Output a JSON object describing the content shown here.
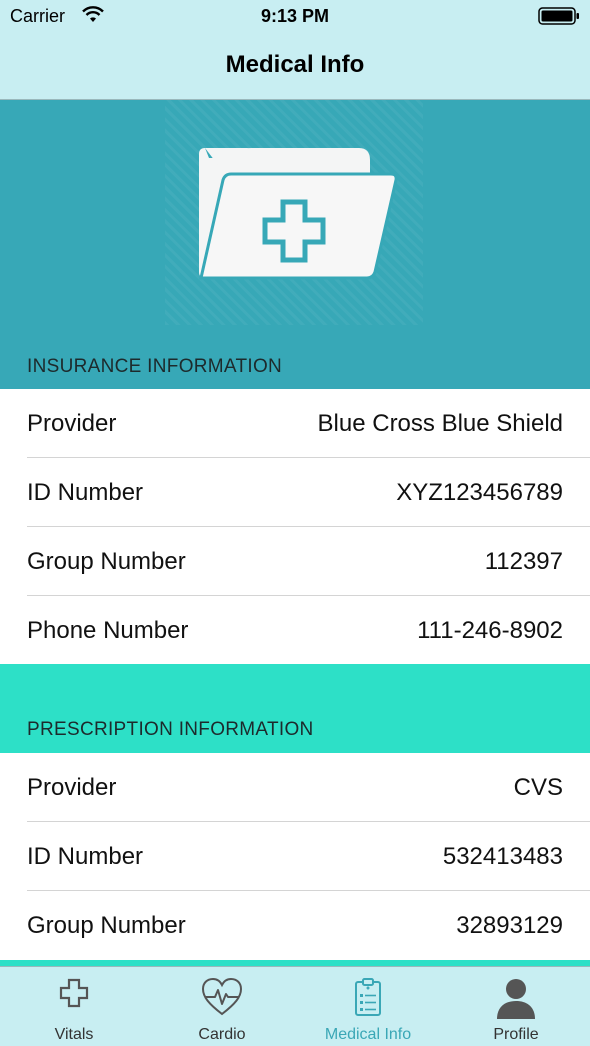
{
  "status_bar": {
    "carrier": "Carrier",
    "time": "9:13 PM"
  },
  "nav": {
    "title": "Medical Info"
  },
  "hero": {
    "icon": "medical-folder-icon"
  },
  "insurance": {
    "header": "INSURANCE INFORMATION",
    "rows": [
      {
        "label": "Provider",
        "value": "Blue Cross Blue Shield"
      },
      {
        "label": "ID Number",
        "value": "XYZ123456789"
      },
      {
        "label": "Group Number",
        "value": "112397"
      },
      {
        "label": "Phone Number",
        "value": "111-246-8902"
      }
    ]
  },
  "prescription": {
    "header": "PRESCRIPTION INFORMATION",
    "rows": [
      {
        "label": "Provider",
        "value": "CVS"
      },
      {
        "label": "ID Number",
        "value": "532413483"
      },
      {
        "label": "Group Number",
        "value": "32893129"
      }
    ]
  },
  "tabs": [
    {
      "label": "Vitals",
      "icon": "plus-outline-icon"
    },
    {
      "label": "Cardio",
      "icon": "heart-pulse-icon"
    },
    {
      "label": "Medical Info",
      "icon": "clipboard-icon",
      "active": true
    },
    {
      "label": "Profile",
      "icon": "person-icon"
    }
  ],
  "colors": {
    "hero": "#37a8b7",
    "accent": "#2de0c7",
    "bar": "#c8eef2",
    "active_tab": "#3aa7b6"
  }
}
